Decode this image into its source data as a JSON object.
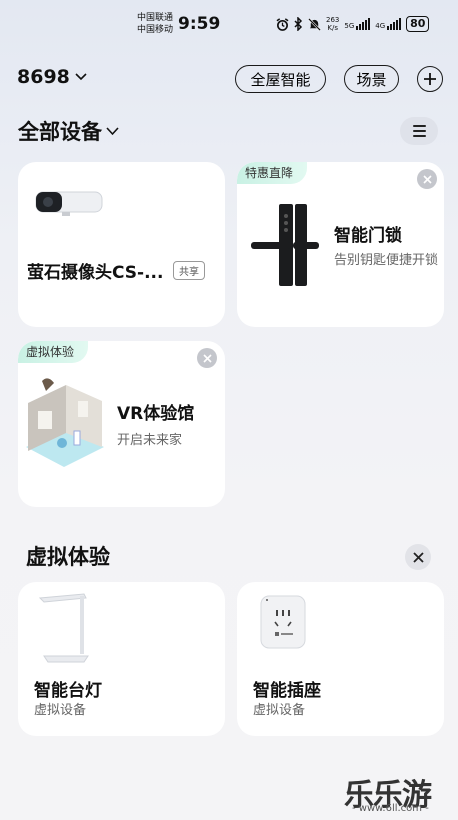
{
  "status_bar": {
    "carrier1": "中国联通",
    "carrier2": "中国移动",
    "time": "9:59",
    "net_speed_value": "263",
    "net_speed_unit": "K/s",
    "sim1_gen": "5G",
    "sim2_gen": "4G",
    "battery": "80"
  },
  "header": {
    "home_name": "8698",
    "smart_label": "全屋智能",
    "scene_label": "场景"
  },
  "devices_section": {
    "title": "全部设备"
  },
  "devices": [
    {
      "name": "萤石摄像头CS-...",
      "badge": "共享",
      "icon": "camera-icon"
    },
    {
      "tag": "特惠直降",
      "name": "智能门锁",
      "subtitle": "告别钥匙便捷开锁",
      "icon": "door-lock-icon"
    },
    {
      "tag": "虚拟体验",
      "name": "VR体验馆",
      "subtitle": "开启未来家",
      "icon": "vr-room-icon"
    }
  ],
  "virtual_section": {
    "title": "虚拟体验",
    "items": [
      {
        "name": "智能台灯",
        "subtitle": "虚拟设备",
        "icon": "desk-lamp-icon"
      },
      {
        "name": "智能插座",
        "subtitle": "虚拟设备",
        "icon": "smart-plug-icon"
      }
    ]
  },
  "watermark": {
    "text": "乐乐游戏",
    "url": "- www.6ll.com -"
  }
}
